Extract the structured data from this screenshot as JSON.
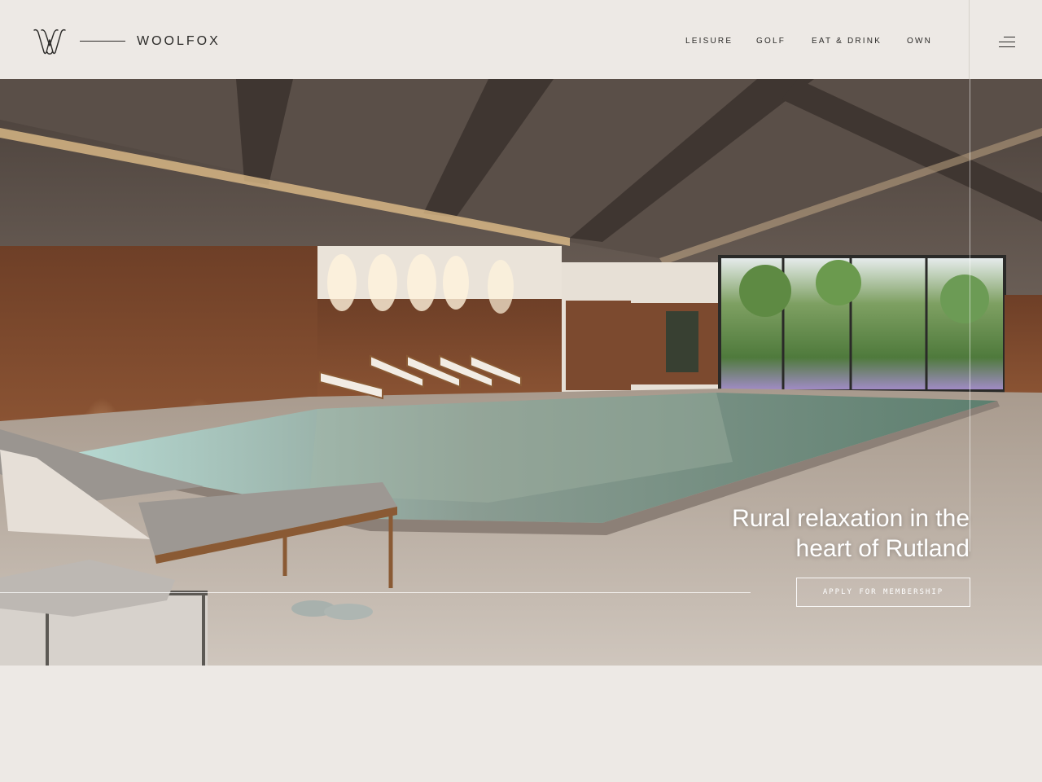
{
  "brand": {
    "name": "WOOLFOX",
    "logo_icon": "woolfox-w-monogram"
  },
  "nav": {
    "items": [
      {
        "label": "LEISURE"
      },
      {
        "label": "GOLF"
      },
      {
        "label": "EAT & DRINK"
      },
      {
        "label": "OWN"
      }
    ],
    "menu_icon": "hamburger-menu-icon"
  },
  "hero": {
    "headline_line1": "Rural relaxation in the",
    "headline_line2": "heart of Rutland",
    "cta_label": "APPLY FOR MEMBERSHIP",
    "image_subject": "indoor-pool-image"
  },
  "colors": {
    "background": "#ede9e5",
    "text": "#2b2a28",
    "hero_text": "#ffffff"
  }
}
